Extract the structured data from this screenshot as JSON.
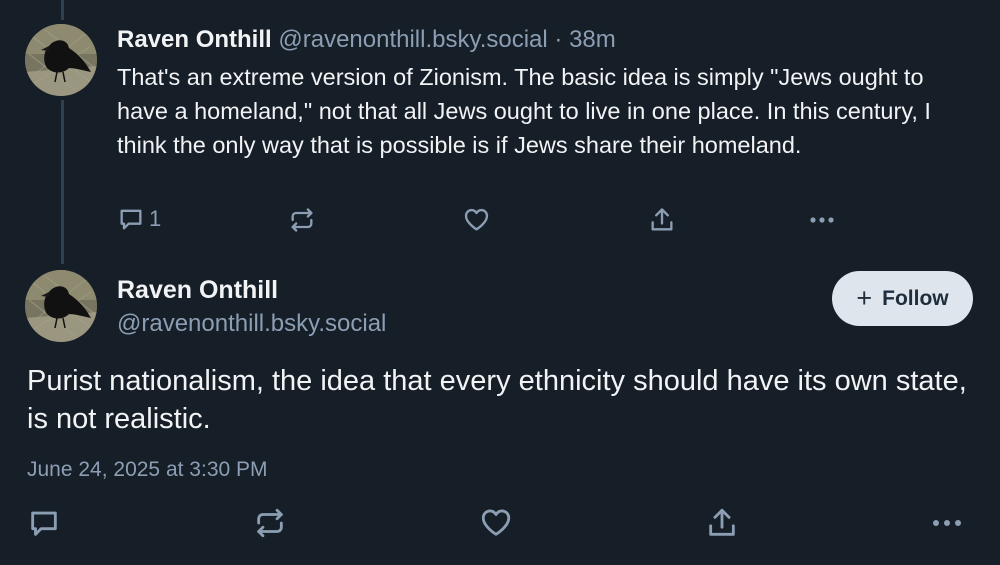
{
  "parent_post": {
    "author_name": "Raven Onthill",
    "author_handle": "@ravenonthill.bsky.social",
    "separator": "·",
    "age": "38m",
    "text": "That's an extreme version of Zionism. The basic idea is simply \"Jews ought to have a homeland,\" not that all Jews ought to live in one place. In this century, I think the only way that is possible is if Jews share their homeland.",
    "reply_count": "1",
    "icons": {
      "reply": "reply-icon",
      "repost": "repost-icon",
      "like": "heart-icon",
      "share": "share-icon",
      "more": "more-icon"
    }
  },
  "main_post": {
    "author_name": "Raven Onthill",
    "author_handle": "@ravenonthill.bsky.social",
    "follow_label": "Follow",
    "follow_icon": "+",
    "text": "Purist nationalism, the idea that every ethnicity should have its own state, is not realistic.",
    "timestamp": "June 24, 2025 at 3:30 PM",
    "icons": {
      "reply": "reply-icon",
      "repost": "repost-icon",
      "like": "heart-icon",
      "share": "share-icon",
      "more": "more-icon"
    }
  },
  "colors": {
    "background": "#161e27",
    "primary_text": "#f1f3f5",
    "secondary_text": "#8c9eb3",
    "thread_line": "#2e4052",
    "follow_button_bg": "#dfe5ec",
    "follow_button_text": "#1f2d3d"
  }
}
